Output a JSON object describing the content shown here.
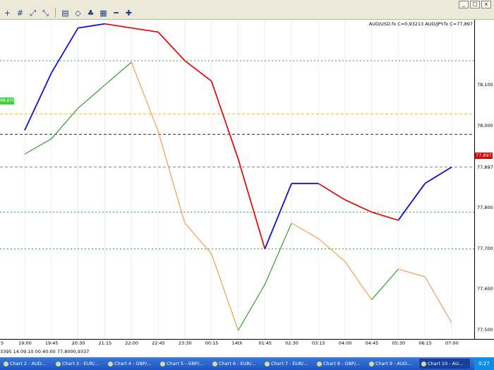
{
  "window": {
    "controls": [
      "_",
      "□",
      "x"
    ]
  },
  "toolbar": {
    "icons": [
      "crosshair-icon",
      "grid-icon",
      "zoom-in-icon",
      "zoom-out-icon",
      "chart-type-icon",
      "eraser-icon",
      "color-icon",
      "properties-icon",
      "minus-icon",
      "plus-icon"
    ]
  },
  "legend": {
    "text": "AUD/USD.fx C=0,93213  AUD/JPY.fx C=77,897"
  },
  "price_axis": {
    "labels": [
      "78,100",
      "78,000",
      "77,897",
      "77,800",
      "77,700",
      "77,600",
      "77,500"
    ],
    "current_tag": "77,897",
    "current_tag_color": "#e00000"
  },
  "left_tag": "98,870",
  "time_axis": {
    "labels": [
      "5",
      "19:00",
      "19:45",
      "20:30",
      "21:15",
      "22:00",
      "22:45",
      "23:30",
      "00:15",
      "14th",
      "01:45",
      "02:30",
      "03:15",
      "04:00",
      "04:45",
      "05:30",
      "06:15",
      "07:00"
    ]
  },
  "info_bar": {
    "text": "3395   14.09.10 00:40:00  77,8000,9337"
  },
  "taskbar": {
    "tabs": [
      "Chart 2 - AUD...",
      "Chart 3 - EUR/...",
      "Chart 4 - GBP/...",
      "Chart 5 - GBP/...",
      "Chart 6 - EUR/...",
      "Chart 7 - EUR/...",
      "Chart 8 - GBP/...",
      "Chart 9 - AUD...",
      "Chart 10 - AU..."
    ],
    "clock": "0:27"
  },
  "chart_data": [
    {
      "type": "line",
      "title": "AUD/USD.fx C=0,93213",
      "series": [
        {
          "name": "AUD/USD.fx",
          "color_up": "#3a9a3a",
          "color_down": "#f0a050",
          "x": [
            "19:00",
            "19:45",
            "20:30",
            "21:15",
            "22:00",
            "22:45",
            "23:30",
            "00:15",
            "01:00",
            "01:45",
            "02:30",
            "03:15",
            "04:00",
            "04:45",
            "05:30",
            "06:15",
            "07:00"
          ],
          "values": [
            0.9335,
            0.9337,
            0.9341,
            0.9344,
            0.9347,
            0.9338,
            0.9326,
            0.9322,
            0.9312,
            0.9318,
            0.9326,
            0.9324,
            0.9321,
            0.9316,
            0.932,
            0.9319,
            0.9313
          ]
        }
      ]
    },
    {
      "type": "line",
      "title": "AUD/JPY.fx C=77,897",
      "ylim": [
        77.48,
        78.26
      ],
      "ylabel": "",
      "series": [
        {
          "name": "AUD/JPY.fx",
          "color_up": "#1010d0",
          "color_down": "#e01010",
          "x": [
            "19:00",
            "19:45",
            "20:30",
            "21:15",
            "22:00",
            "22:45",
            "23:30",
            "00:15",
            "01:00",
            "01:45",
            "02:30",
            "03:15",
            "04:00",
            "04:45",
            "05:30",
            "06:15",
            "07:00"
          ],
          "values": [
            77.99,
            78.13,
            78.24,
            78.25,
            78.24,
            78.23,
            78.16,
            78.11,
            77.92,
            77.7,
            77.86,
            77.86,
            77.82,
            77.79,
            77.77,
            77.86,
            77.9
          ]
        }
      ],
      "horizontal_levels": [
        {
          "value": 78.16,
          "style": "dotted",
          "color": "#3a9a3a"
        },
        {
          "value": 78.03,
          "style": "dashed",
          "color": "#e0c000"
        },
        {
          "value": 77.98,
          "style": "dashed",
          "color": "#222222"
        },
        {
          "value": 77.9,
          "style": "dashed",
          "color": "#888888"
        },
        {
          "value": 77.79,
          "style": "dotted",
          "color": "#3a9a3a"
        },
        {
          "value": 77.7,
          "style": "dotted",
          "color": "#3a9a3a"
        }
      ],
      "grid": true
    }
  ]
}
